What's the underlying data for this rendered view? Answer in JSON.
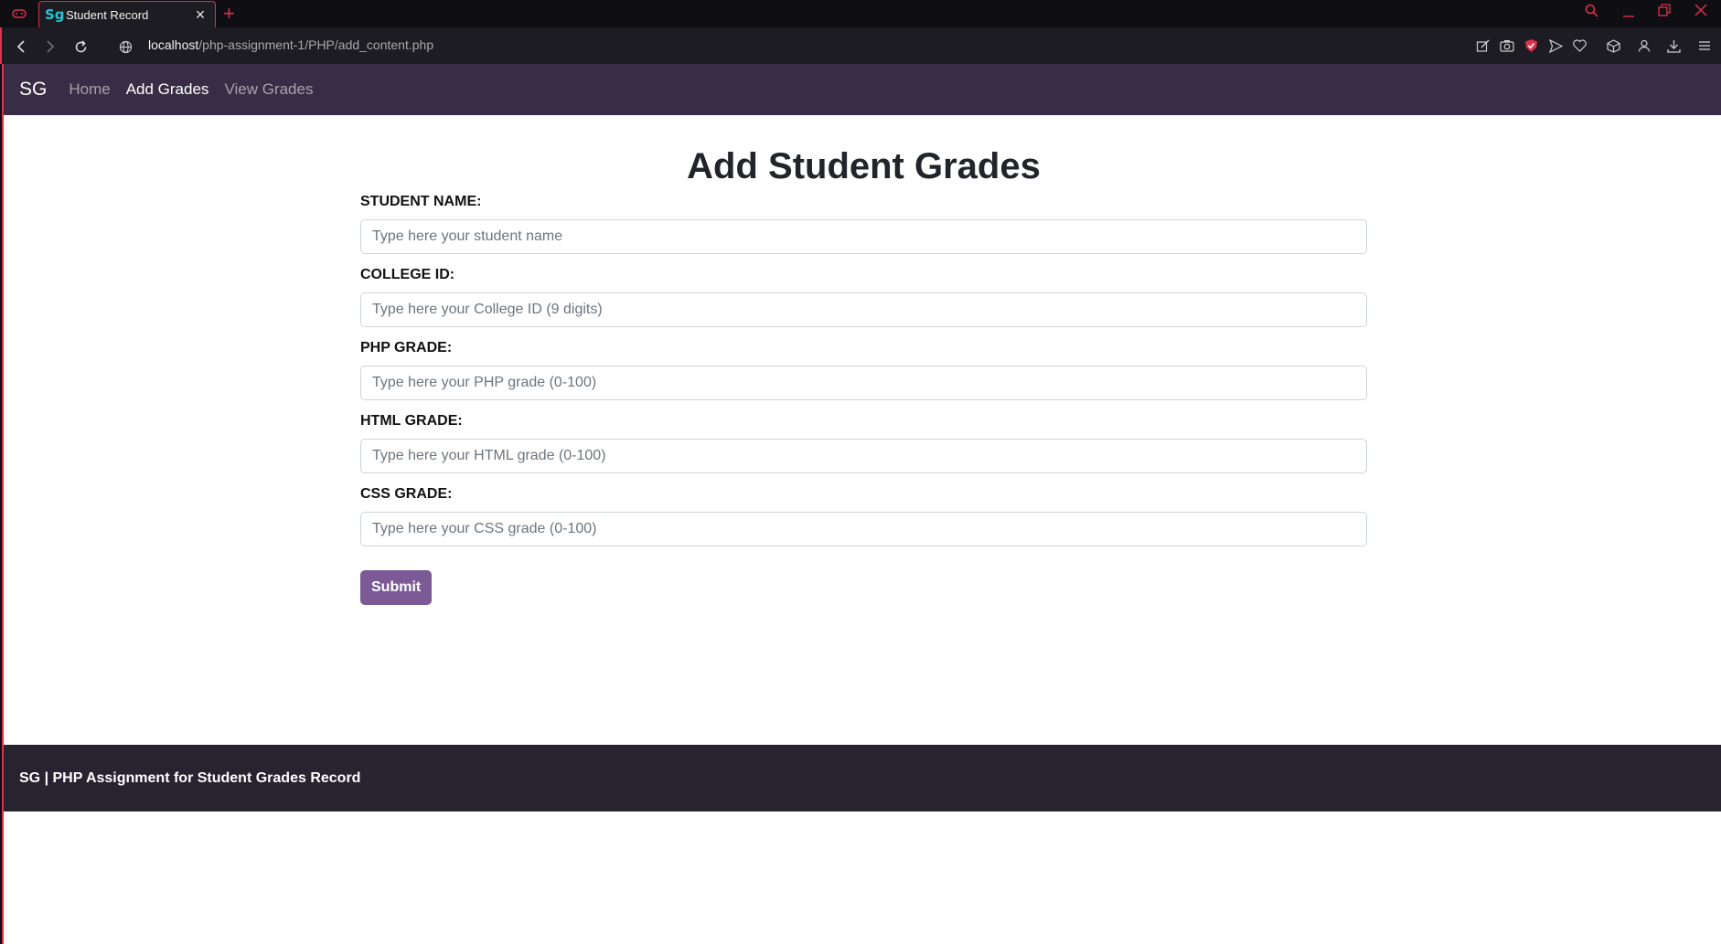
{
  "browser": {
    "tab_title": "Student Record",
    "tab_favicon": "Sg",
    "url_host": "localhost",
    "url_path": "/php-assignment-1/PHP/add_content.php"
  },
  "navbar": {
    "brand": "SG",
    "links": [
      {
        "label": "Home"
      },
      {
        "label": "Add Grades"
      },
      {
        "label": "View Grades"
      }
    ]
  },
  "form": {
    "title": "Add Student Grades",
    "fields": [
      {
        "label": "STUDENT NAME:",
        "placeholder": "Type here your student name",
        "value": ""
      },
      {
        "label": "COLLEGE ID:",
        "placeholder": "Type here your College ID (9 digits)",
        "value": ""
      },
      {
        "label": "PHP GRADE:",
        "placeholder": "Type here your PHP grade (0-100)",
        "value": ""
      },
      {
        "label": "HTML GRADE:",
        "placeholder": "Type here your HTML grade (0-100)",
        "value": ""
      },
      {
        "label": "CSS GRADE:",
        "placeholder": "Type here your CSS grade (0-100)",
        "value": ""
      }
    ],
    "submit_label": "Submit"
  },
  "footer": {
    "text": "SG | PHP Assignment for Student Grades Record"
  },
  "colors": {
    "navbar": "#392d45",
    "footer": "#27232f",
    "submit": "#7b5a96",
    "browser_accent": "#e0304a"
  }
}
